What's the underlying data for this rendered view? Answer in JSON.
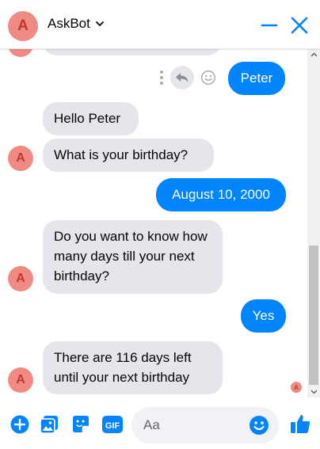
{
  "header": {
    "avatar_letter": "A",
    "title": "AskBot"
  },
  "messages": [
    {
      "from": "user",
      "text": "Peter"
    },
    {
      "from": "bot",
      "text": "Hello Peter"
    },
    {
      "from": "bot",
      "text": "What is your birthday?",
      "avatar": "A"
    },
    {
      "from": "user",
      "text": "August 10, 2000"
    },
    {
      "from": "bot",
      "text": "Do you want to know how many days till your next birthday?",
      "avatar": "A"
    },
    {
      "from": "user",
      "text": "Yes"
    },
    {
      "from": "bot",
      "text": "There are 116 days left until your next birthday",
      "avatar": "A"
    }
  ],
  "seen_avatar_letter": "A",
  "composer": {
    "placeholder": "Aa"
  },
  "colors": {
    "accent": "#0084ff",
    "bot_bubble": "#e4e6eb",
    "avatar_bg": "#f08a85",
    "avatar_letter": "#c0392b"
  },
  "icons": [
    "chevron-down-icon",
    "minimize-icon",
    "close-icon",
    "more-dots-icon",
    "reply-icon",
    "react-emoji-icon",
    "add-icon",
    "photo-icon",
    "sticker-icon",
    "gif-icon",
    "emoji-icon",
    "like-icon",
    "scroll-up-icon",
    "scroll-down-icon"
  ]
}
